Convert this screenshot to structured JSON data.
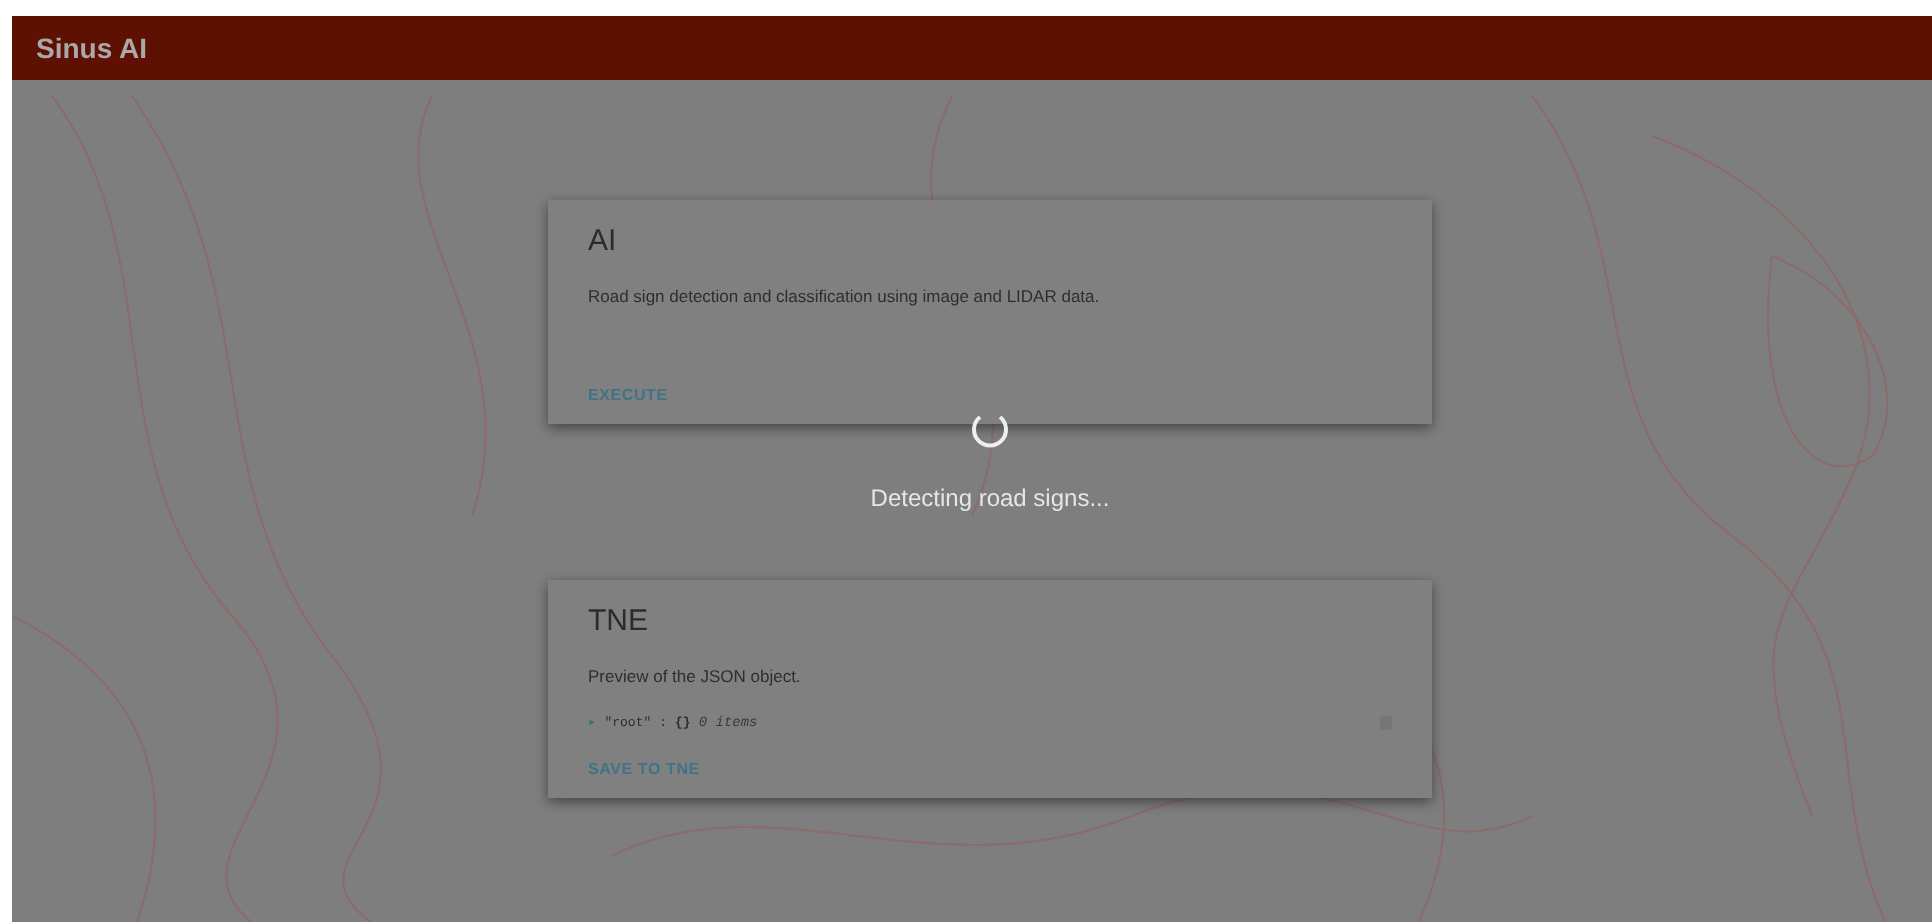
{
  "app_bar": {
    "title": "Sinus AI"
  },
  "cards": [
    {
      "kind": "description",
      "title": "AI",
      "text": "Road sign detection and classification using image and LIDAR data.",
      "action": "EXECUTE"
    },
    {
      "kind": "json",
      "title": "TNE",
      "text": "Preview of the JSON object.",
      "json_preview": {
        "toggle": "▸",
        "key": "\"root\"",
        "separator": ":",
        "value": "{}",
        "count": "0 items"
      },
      "action": "SAVE TO TNE"
    }
  ],
  "loading": {
    "message": "Detecting road signs..."
  }
}
